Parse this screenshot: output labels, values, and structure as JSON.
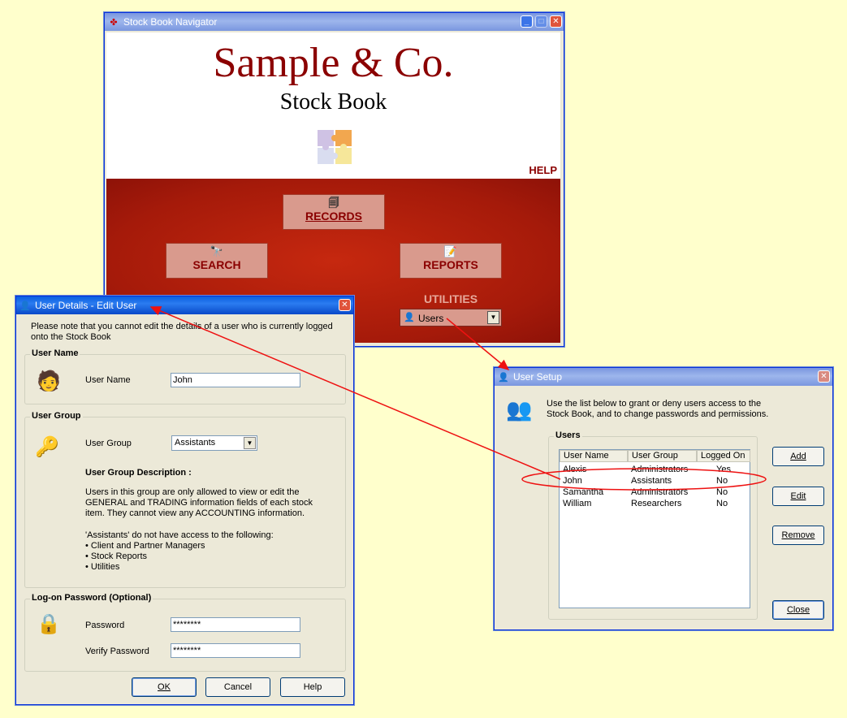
{
  "navigator": {
    "title": "Stock Book Navigator",
    "company": "Sample & Co.",
    "subtitle": "Stock Book",
    "help": "HELP",
    "records": "RECORDS",
    "search": "SEARCH",
    "reports": "REPORTS",
    "utilities": "UTILITIES",
    "utilities_selected": "Users"
  },
  "user_details": {
    "title": "User Details - Edit User",
    "note": "Please note that you cannot edit the details of a user who is currently logged onto the Stock Book",
    "user_name_group": "User Name",
    "user_name_label": "User Name",
    "user_name_value": "John",
    "user_group_group": "User Group",
    "user_group_label": "User Group",
    "user_group_value": "Assistants",
    "desc_title": "User Group Description :",
    "desc_text1": "Users in this group are only allowed to view or edit the GENERAL and TRADING information fields of each stock item. They cannot view any ACCOUNTING information.",
    "desc_text2": "'Assistants' do not have access to the following:",
    "desc_items": [
      "Client and Partner Managers",
      "Stock Reports",
      "Utilities"
    ],
    "password_group": "Log-on Password  (Optional)",
    "password_label": "Password",
    "password_value": "********",
    "verify_label": "Verify Password",
    "verify_value": "********",
    "ok": "OK",
    "cancel": "Cancel",
    "help": "Help"
  },
  "user_setup": {
    "title": "User Setup",
    "intro": "Use the list below to grant or deny users access to the Stock Book, and to change passwords and permissions.",
    "users_group": "Users",
    "columns": [
      "User Name",
      "User Group",
      "Logged On"
    ],
    "rows": [
      [
        "Alexis",
        "Administrators",
        "Yes"
      ],
      [
        "John",
        "Assistants",
        "No"
      ],
      [
        "Samantha",
        "Administrators",
        "No"
      ],
      [
        "William",
        "Researchers",
        "No"
      ]
    ],
    "add": "Add",
    "edit": "Edit",
    "remove": "Remove",
    "close": "Close"
  },
  "colors": {
    "brand_red": "#8b0000",
    "nav_red": "#b01e0e",
    "callout_red": "#ee1111",
    "xp_blue": "#0a5fe0"
  }
}
